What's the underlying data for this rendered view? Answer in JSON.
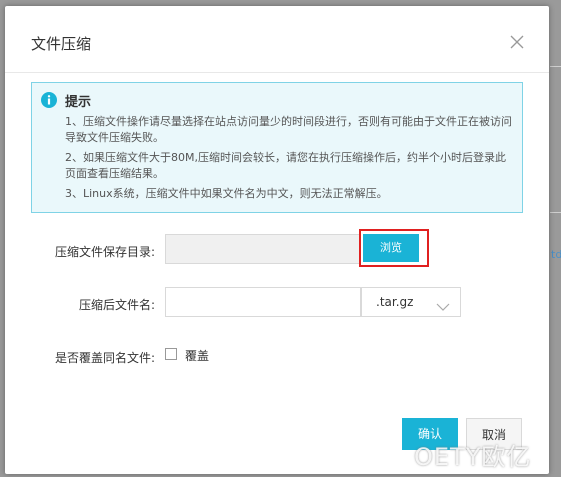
{
  "dialog": {
    "title": "文件压缩",
    "close_icon": "close-icon"
  },
  "tip": {
    "icon": "info-icon",
    "title": "提示",
    "lines": [
      "1、压缩文件操作请尽量选择在站点访问量少的时间段进行，否则有可能由于文件正在被访问导致文件压缩失败。",
      "2、如果压缩文件大于80M,压缩时间会较长，请您在执行压缩操作后，约半个小时后登录此页面查看压缩结果。",
      "3、Linux系统，压缩文件中如果文件名为中文，则无法正常解压。"
    ],
    "colors": {
      "border": "#7fd3e6",
      "background": "#eaf8fb",
      "icon": "#1ab3d6"
    }
  },
  "form": {
    "save_dir_label": "压缩文件保存目录:",
    "save_dir_value": "",
    "browse_label": "浏览",
    "filename_label": "压缩后文件名:",
    "filename_value": "",
    "extension_selected": ".tar.gz",
    "overwrite_label": "是否覆盖同名文件:",
    "overwrite_checkbox_label": "覆盖",
    "overwrite_checked": false
  },
  "actions": {
    "ok_label": "确认",
    "cancel_label": "取消"
  },
  "background": {
    "edge_text": "td"
  },
  "watermark": "OETY欧亿",
  "colors": {
    "accent": "#1ab3d6",
    "highlight": "#e02020"
  }
}
